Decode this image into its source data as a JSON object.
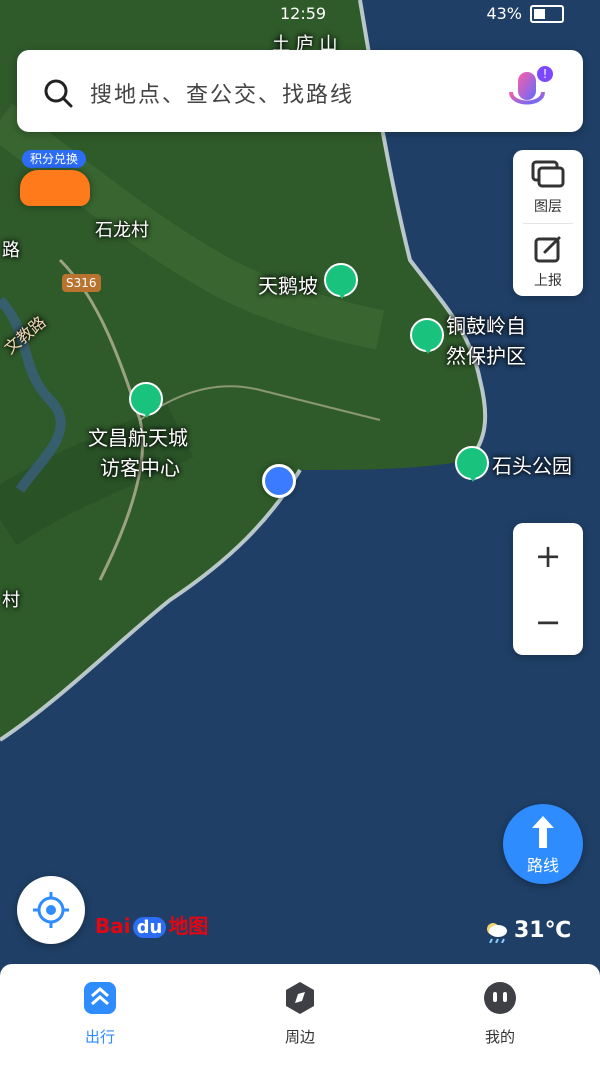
{
  "status": {
    "time": "12:59",
    "battery": "43%"
  },
  "search": {
    "placeholder": "搜地点、查公交、找路线",
    "badge": "!"
  },
  "side_panel": {
    "layers_label": "图层",
    "report_label": "上报"
  },
  "zoom": {
    "in": "+",
    "out": "−"
  },
  "route": {
    "label": "路线"
  },
  "weather": {
    "temp": "31℃"
  },
  "logo": {
    "left": "Bai",
    "du": "du",
    "right": "地图"
  },
  "car": {
    "exchange_label": "积分兑换"
  },
  "map_labels": {
    "top": "土 庐 山",
    "shilong": "石龙村",
    "tianepo": "天鹅坡",
    "tonggu_line1": "铜鼓岭自",
    "tonggu_line2": "然保护区",
    "wenchang_line1": "文昌航天城",
    "wenchang_line2": "访客中心",
    "shitou": "石头公园",
    "village_left": "村",
    "road_left": "路",
    "road_badge": "S316",
    "wenjiao": "文教路"
  },
  "tabbar": {
    "tabs": [
      {
        "label": "出行",
        "active": true
      },
      {
        "label": "周边",
        "active": false
      },
      {
        "label": "我的",
        "active": false
      }
    ]
  },
  "colors": {
    "accent": "#2e8cff",
    "sea": "#1f3f66",
    "land": "#2f5a2a"
  },
  "icons": {
    "search": "search-icon",
    "mic": "microphone-icon",
    "layers": "layers-icon",
    "report": "edit-icon",
    "locate": "target-icon",
    "route": "arrow-up-icon",
    "poi": "tree-icon",
    "weather": "cloud-rain-icon",
    "tab_travel": "chevrons-up-icon",
    "tab_nearby": "compass-icon",
    "tab_me": "face-icon"
  }
}
